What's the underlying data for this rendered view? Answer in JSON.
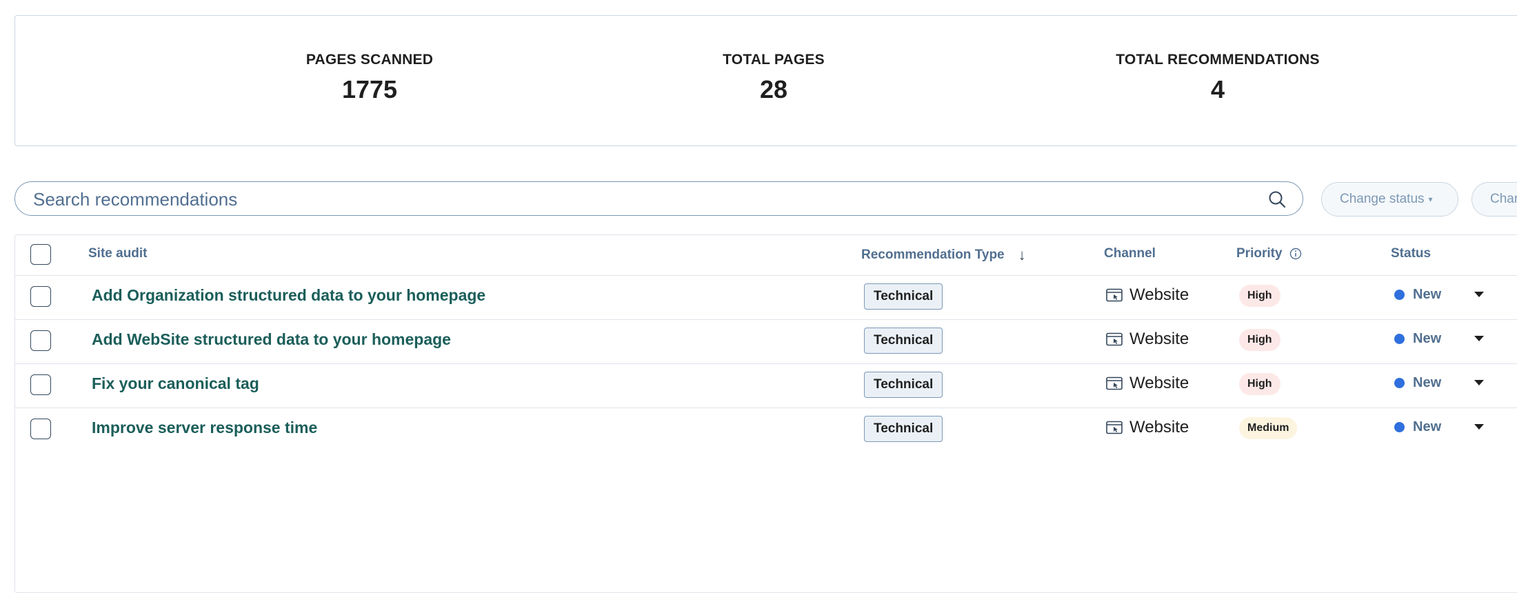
{
  "stats": [
    {
      "label": "PAGES SCANNED",
      "value": "1775"
    },
    {
      "label": "TOTAL PAGES",
      "value": "28"
    },
    {
      "label": "TOTAL RECOMMENDATIONS",
      "value": "4"
    }
  ],
  "search": {
    "placeholder": "Search recommendations"
  },
  "actions": {
    "change_status": "Change status",
    "change_second": "Char"
  },
  "table": {
    "headers": {
      "site_audit": "Site audit",
      "recommendation_type": "Recommendation Type",
      "channel": "Channel",
      "priority": "Priority",
      "status": "Status"
    },
    "rows": [
      {
        "title": "Add Organization structured data to your homepage",
        "type": "Technical",
        "channel": "Website",
        "priority": "High",
        "status": "New"
      },
      {
        "title": "Add WebSite structured data to your homepage",
        "type": "Technical",
        "channel": "Website",
        "priority": "High",
        "status": "New"
      },
      {
        "title": "Fix your canonical tag",
        "type": "Technical",
        "channel": "Website",
        "priority": "High",
        "status": "New"
      },
      {
        "title": "Improve server response time",
        "type": "Technical",
        "channel": "Website",
        "priority": "Medium",
        "status": "New"
      }
    ]
  },
  "colors": {
    "link": "#1b5e5a",
    "status_new": "#2f6fde",
    "priority_high_bg": "#fde8e8",
    "priority_medium_bg": "#fdf4e0"
  }
}
